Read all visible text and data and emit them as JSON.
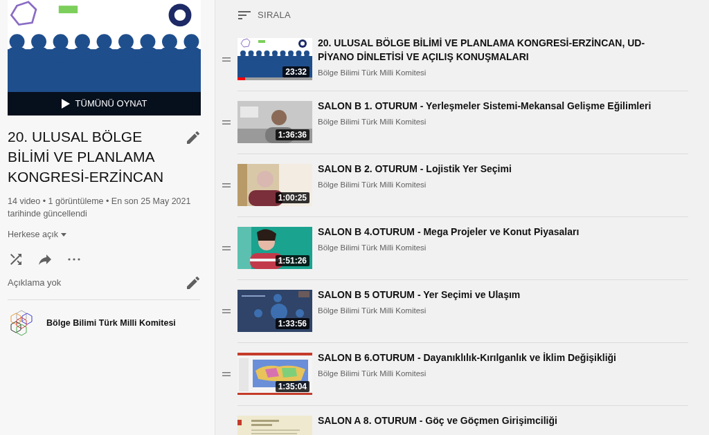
{
  "playlist": {
    "play_all": "TÜMÜNÜ OYNAT",
    "title": "20. ULUSAL BÖLGE BİLİMİ VE PLANLAMA KONGRESİ-ERZİNCAN",
    "stats": "14 video • 1 görüntüleme • En son 25 May 2021 tarihinde güncellendi",
    "visibility": "Herkese açık",
    "description": "Açıklama yok",
    "owner": "Bölge Bilimi Türk Milli Komitesi"
  },
  "sort": {
    "label": "SIRALA"
  },
  "videos": [
    {
      "title": "20. ULUSAL BÖLGE BİLİMİ VE PLANLAMA KONGRESİ-ERZİNCAN, UD-PİYANO DİNLETİSİ VE AÇILIŞ KONUŞMALARI",
      "channel": "Bölge Bilimi Türk Milli Komitesi",
      "duration": "23:32",
      "level": 0.1
    },
    {
      "title": "SALON B 1. OTURUM - Yerleşmeler Sistemi-Mekansal Gelişme Eğilimleri",
      "channel": "Bölge Bilimi Türk Milli Komitesi",
      "duration": "1:36:36"
    },
    {
      "title": "SALON B 2. OTURUM - Lojistik Yer Seçimi",
      "channel": "Bölge Bilimi Türk Milli Komitesi",
      "duration": "1:00:25"
    },
    {
      "title": "SALON B 4.OTURUM - Mega Projeler ve Konut Piyasaları",
      "channel": "Bölge Bilimi Türk Milli Komitesi",
      "duration": "1:51:26"
    },
    {
      "title": "SALON B 5 OTURUM - Yer Seçimi ve Ulaşım",
      "channel": "Bölge Bilimi Türk Milli Komitesi",
      "duration": "1:33:56"
    },
    {
      "title": "SALON B 6.OTURUM - Dayanıklılık-Kırılganlık ve İklim Değişikliği",
      "channel": "Bölge Bilimi Türk Milli Komitesi",
      "duration": "1:35:04"
    },
    {
      "title": "SALON A 8. OTURUM - Göç ve Göçmen Girişimciliği"
    }
  ]
}
